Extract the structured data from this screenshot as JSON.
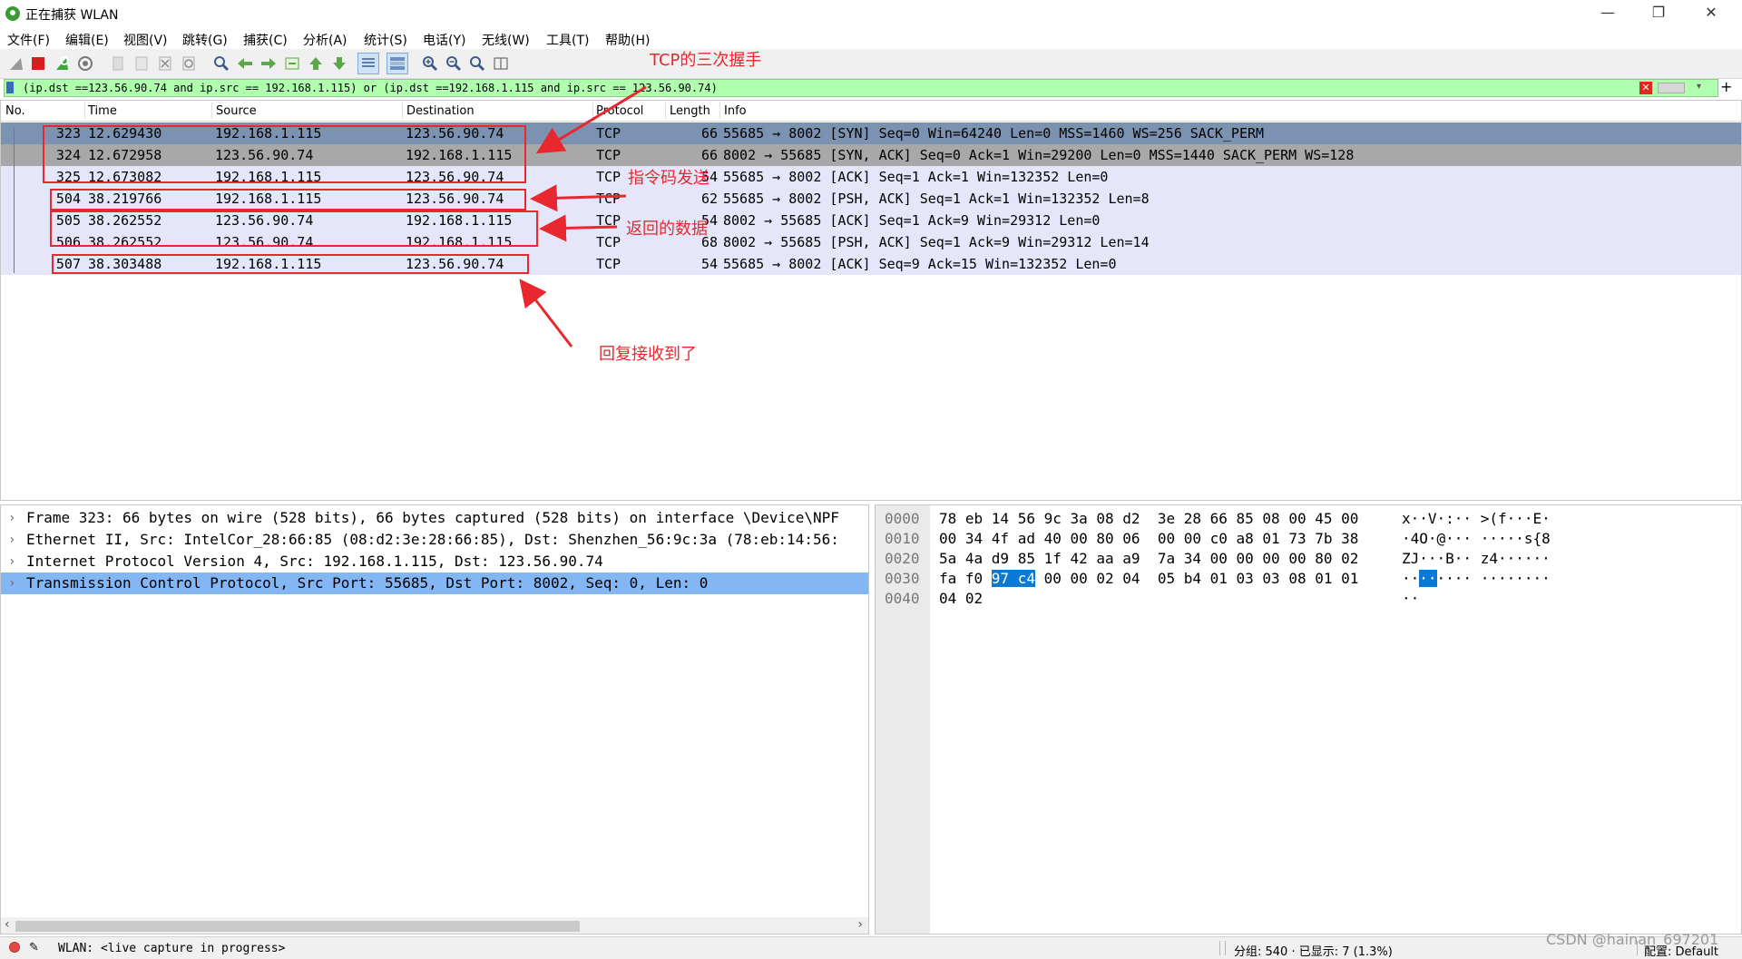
{
  "window": {
    "title": "正在捕获 WLAN",
    "minimize": "—",
    "restore": "❐",
    "close": "✕"
  },
  "menu": [
    "文件(F)",
    "编辑(E)",
    "视图(V)",
    "跳转(G)",
    "捕获(C)",
    "分析(A)",
    "统计(S)",
    "电话(Y)",
    "无线(W)",
    "工具(T)",
    "帮助(H)"
  ],
  "toolbar_icons": [
    "shark-fin-start-icon",
    "stop-capture-icon",
    "restart-capture-icon",
    "capture-options-icon",
    "open-file-icon",
    "save-file-icon",
    "close-file-icon",
    "reload-file-icon",
    "find-packet-icon",
    "go-back-icon",
    "go-forward-icon",
    "go-to-packet-icon",
    "first-packet-icon",
    "last-packet-icon",
    "auto-scroll-icon",
    "colorize-icon",
    "zoom-in-icon",
    "zoom-out-icon",
    "normal-size-icon",
    "resize-columns-icon"
  ],
  "filter": {
    "text": "(ip.dst ==123.56.90.74 and ip.src == 192.168.1.115) or (ip.dst ==192.168.1.115 and ip.src == 123.56.90.74)",
    "clear": "✕",
    "add": "+"
  },
  "columns": [
    "No.",
    "Time",
    "Source",
    "Destination",
    "Protocol",
    "Length",
    "Info"
  ],
  "packets": [
    {
      "no": "323",
      "time": "12.629430",
      "src": "192.168.1.115",
      "dst": "123.56.90.74",
      "proto": "TCP",
      "len": "66",
      "info": "55685 → 8002 [SYN] Seq=0 Win=64240 Len=0 MSS=1460 WS=256 SACK_PERM"
    },
    {
      "no": "324",
      "time": "12.672958",
      "src": "123.56.90.74",
      "dst": "192.168.1.115",
      "proto": "TCP",
      "len": "66",
      "info": "8002 → 55685 [SYN, ACK] Seq=0 Ack=1 Win=29200 Len=0 MSS=1440 SACK_PERM WS=128"
    },
    {
      "no": "325",
      "time": "12.673082",
      "src": "192.168.1.115",
      "dst": "123.56.90.74",
      "proto": "TCP",
      "len": "54",
      "info": "55685 → 8002 [ACK] Seq=1 Ack=1 Win=132352 Len=0"
    },
    {
      "no": "504",
      "time": "38.219766",
      "src": "192.168.1.115",
      "dst": "123.56.90.74",
      "proto": "TCP",
      "len": "62",
      "info": "55685 → 8002 [PSH, ACK] Seq=1 Ack=1 Win=132352 Len=8"
    },
    {
      "no": "505",
      "time": "38.262552",
      "src": "123.56.90.74",
      "dst": "192.168.1.115",
      "proto": "TCP",
      "len": "54",
      "info": "8002 → 55685 [ACK] Seq=1 Ack=9 Win=29312 Len=0"
    },
    {
      "no": "506",
      "time": "38.262552",
      "src": "123.56.90.74",
      "dst": "192.168.1.115",
      "proto": "TCP",
      "len": "68",
      "info": "8002 → 55685 [PSH, ACK] Seq=1 Ack=9 Win=29312 Len=14"
    },
    {
      "no": "507",
      "time": "38.303488",
      "src": "192.168.1.115",
      "dst": "123.56.90.74",
      "proto": "TCP",
      "len": "54",
      "info": "55685 → 8002 [ACK] Seq=9 Ack=15 Win=132352 Len=0"
    }
  ],
  "row_colors": {
    "selected": "#7b93b0",
    "related": "#a8a8a8",
    "tcp": "#e6e6fa"
  },
  "details": [
    {
      "arrow": "›",
      "text": "Frame 323: 66 bytes on wire (528 bits), 66 bytes captured (528 bits) on interface \\Device\\NPF"
    },
    {
      "arrow": "›",
      "text": "Ethernet II, Src: IntelCor_28:66:85 (08:d2:3e:28:66:85), Dst: Shenzhen_56:9c:3a (78:eb:14:56:"
    },
    {
      "arrow": "›",
      "text": "Internet Protocol Version 4, Src: 192.168.1.115, Dst: 123.56.90.74"
    },
    {
      "arrow": "›",
      "text": "Transmission Control Protocol, Src Port: 55685, Dst Port: 8002, Seq: 0, Len: 0"
    }
  ],
  "bytes": [
    {
      "offset": "0000",
      "hex_a": "78 eb 14 56 9c 3a 08 d2  3e 28 66 85 08 00 45 00",
      "ascii": "x··V·:·· >(f···E·"
    },
    {
      "offset": "0010",
      "hex_a": "00 34 4f ad 40 00 80 06  00 00 c0 a8 01 73 7b 38",
      "ascii": "·4O·@··· ·····s{8"
    },
    {
      "offset": "0020",
      "hex_a": "5a 4a d9 85 1f 42 aa a9  7a 34 00 00 00 00 80 02",
      "ascii": "ZJ···B·· z4······"
    },
    {
      "offset": "0030",
      "hex_pre": "fa f0 ",
      "hex_hl": "97 c4",
      "hex_post": " 00 00 02 04  05 b4 01 03 03 08 01 01",
      "ascii_pre": "··",
      "ascii_hl": "··",
      "ascii_post": "···· ········"
    },
    {
      "offset": "0040",
      "hex_a": "04 02",
      "ascii": "··"
    }
  ],
  "status": {
    "text": "WLAN: <live capture in progress>",
    "packets": "分组: 540 · 已显示: 7 (1.3%)",
    "profile": "配置: Default"
  },
  "watermark": "CSDN @hainan_697201",
  "annotations": {
    "handshake": "TCP的三次握手",
    "command_send": "指令码发送",
    "returned_data": "返回的数据",
    "reply_received": "回复接收到了"
  }
}
